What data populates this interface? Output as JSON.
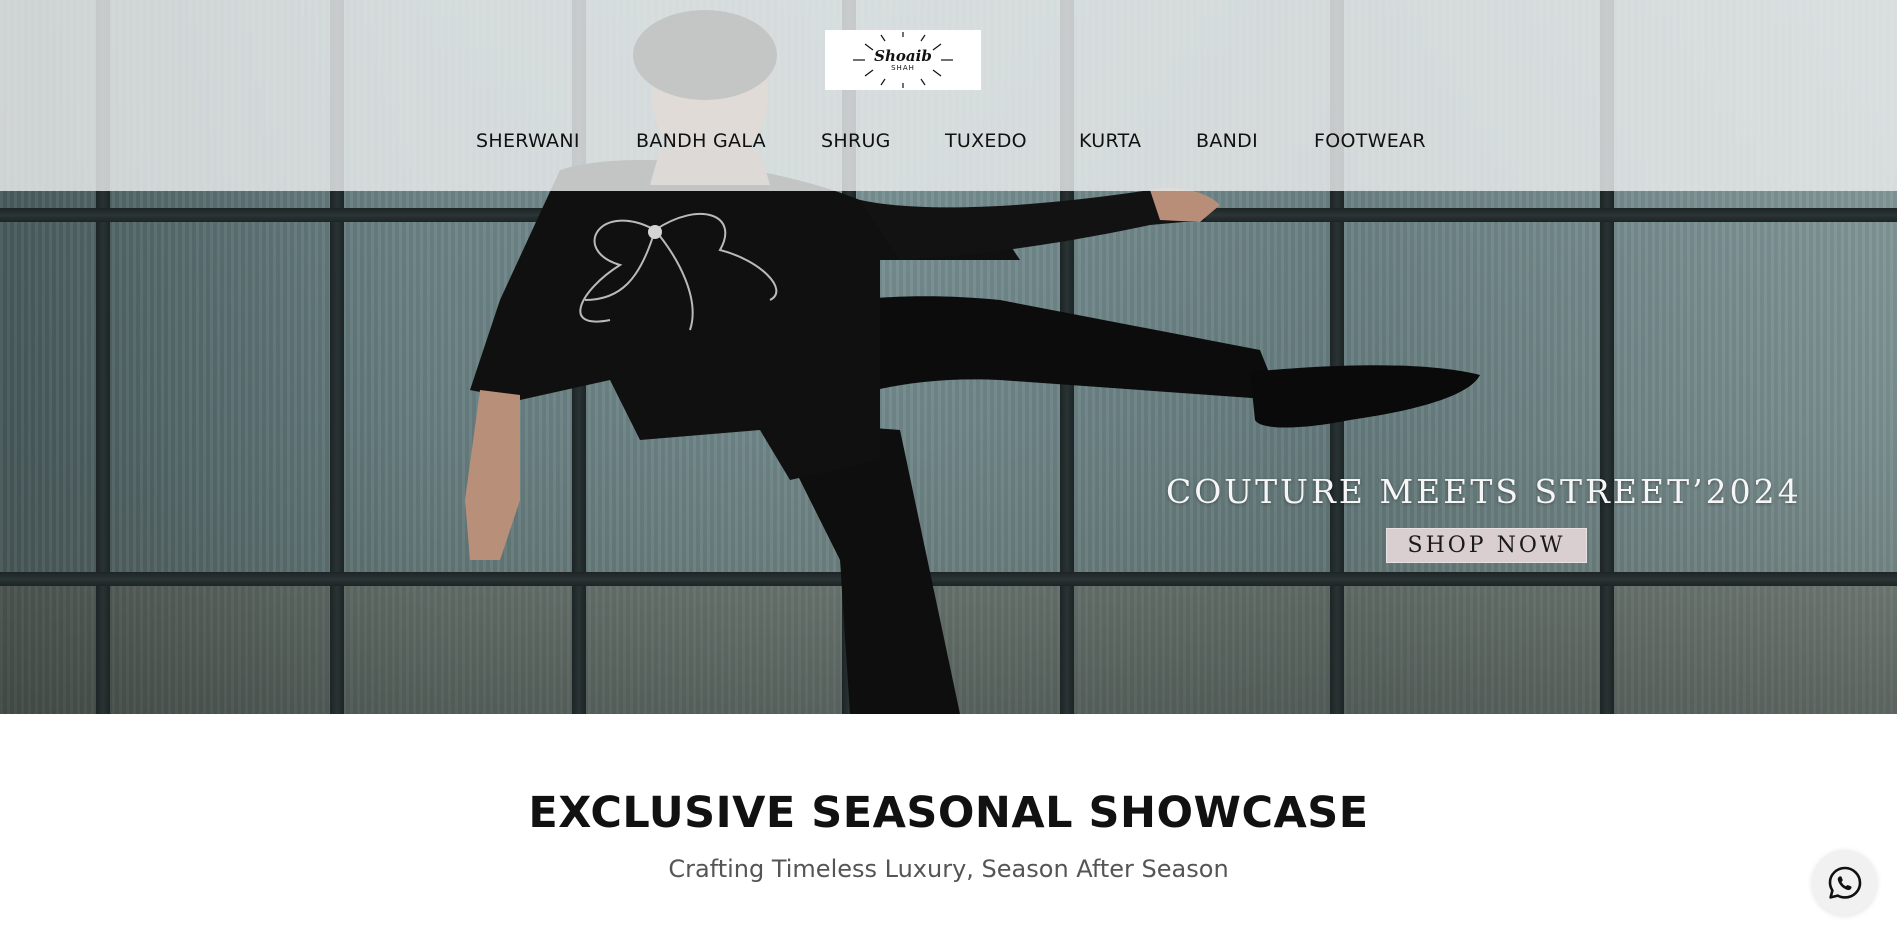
{
  "brand": {
    "logo_name": "Shoaib",
    "logo_sub": "SHAH"
  },
  "nav": {
    "items": [
      {
        "label": "SHERWANI"
      },
      {
        "label": "BANDH GALA"
      },
      {
        "label": "SHRUG"
      },
      {
        "label": "TUXEDO"
      },
      {
        "label": "KURTA"
      },
      {
        "label": "BANDI"
      },
      {
        "label": "FOOTWEAR"
      }
    ]
  },
  "hero": {
    "title": "COUTURE MEETS STREET’2024",
    "cta_label": "SHOP NOW"
  },
  "showcase": {
    "title": "EXCLUSIVE SEASONAL SHOWCASE",
    "subtitle": "Crafting Timeless Luxury, Season After Season"
  },
  "icons": {
    "chat": "whatsapp-chat-icon"
  },
  "colors": {
    "cta_background": "#d9cfd1",
    "header_overlay": "#eceeee",
    "text_dark": "#111111",
    "subtitle_gray": "#555555"
  }
}
